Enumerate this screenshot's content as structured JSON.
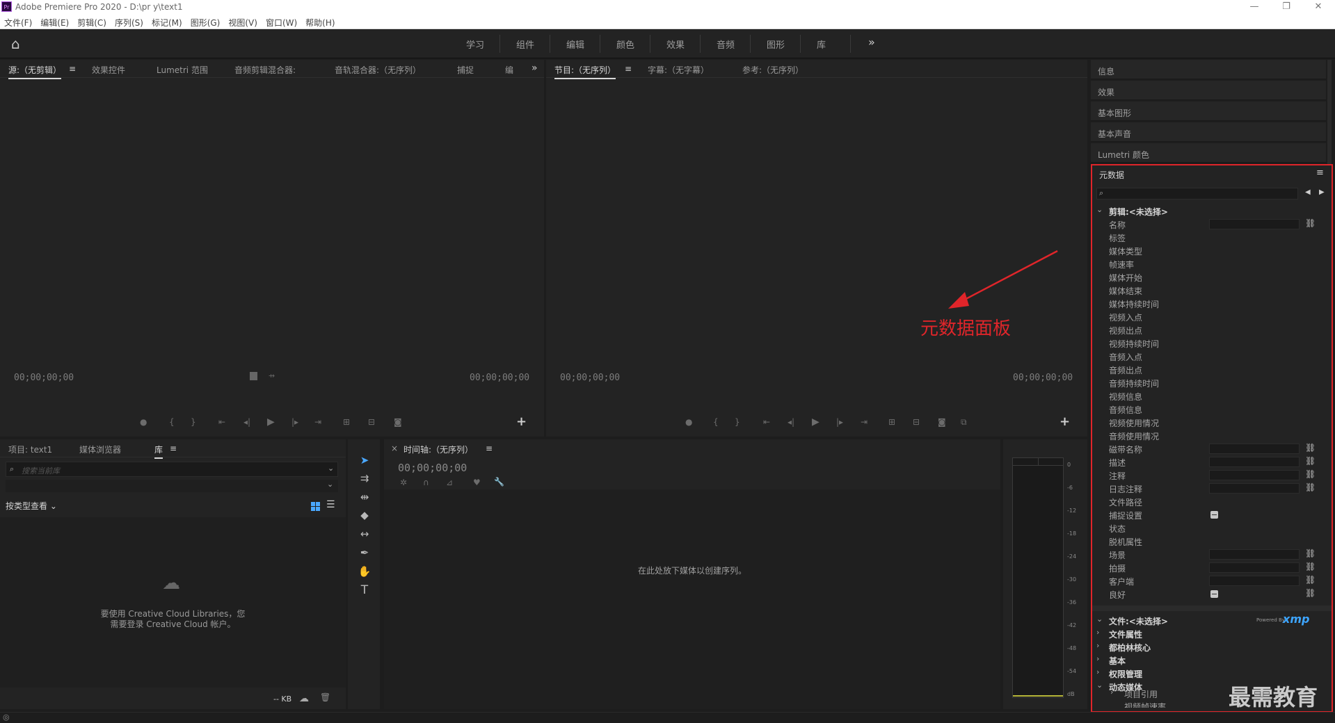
{
  "window": {
    "title": "Adobe Premiere Pro 2020 - D:\\pr y\\text1",
    "app_icon": "Pr",
    "minimize": "—",
    "restore": "❐",
    "close": "✕"
  },
  "menu": [
    "文件(F)",
    "编辑(E)",
    "剪辑(C)",
    "序列(S)",
    "标记(M)",
    "图形(G)",
    "视图(V)",
    "窗口(W)",
    "帮助(H)"
  ],
  "workspaces": [
    "学习",
    "组件",
    "编辑",
    "颜色",
    "效果",
    "音频",
    "图形",
    "库"
  ],
  "workspace_more": "»",
  "source_panel": {
    "tabs": [
      "源:（无剪辑）",
      "效果控件",
      "Lumetri 范围",
      "音频剪辑混合器:",
      "音轨混合器:（无序列）",
      "捕捉",
      "编"
    ],
    "more": "»",
    "timecode_left": "00;00;00;00",
    "timecode_right": "00;00;00;00"
  },
  "program_panel": {
    "tabs": [
      "节目:（无序列）",
      "字幕:（无字幕）",
      "参考:（无序列）"
    ],
    "timecode_left": "00;00;00;00",
    "timecode_right": "00;00;00;00"
  },
  "annotation": {
    "text": "元数据面板",
    "color": "#e0252a"
  },
  "project_panel": {
    "tabs": [
      "项目: text1",
      "媒体浏览器",
      "库"
    ],
    "search_placeholder": "搜索当前库",
    "view_by": "按类型查看",
    "cc_message_line1": "要使用 Creative Cloud Libraries，您",
    "cc_message_line2": "需要登录 Creative Cloud 帐户。",
    "size": "-- KB"
  },
  "timeline_panel": {
    "close": "×",
    "tab": "时间轴:（无序列）",
    "timecode": "00;00;00;00",
    "drop_message": "在此处放下媒体以创建序列。"
  },
  "audio_meter": {
    "labels": [
      "0",
      "-6",
      "-12",
      "-18",
      "-24",
      "-30",
      "-36",
      "-42",
      "-48",
      "-54",
      "dB"
    ]
  },
  "right_tabs": [
    "信息",
    "效果",
    "基本图形",
    "基本声音",
    "Lumetri 颜色"
  ],
  "metadata": {
    "title": "元数据",
    "clip_section": "剪辑:<未选择>",
    "clip_fields": [
      {
        "label": "名称",
        "field": true,
        "link": true
      },
      {
        "label": "标签"
      },
      {
        "label": "媒体类型"
      },
      {
        "label": "帧速率"
      },
      {
        "label": "媒体开始"
      },
      {
        "label": "媒体结束"
      },
      {
        "label": "媒体持续时间"
      },
      {
        "label": "视频入点"
      },
      {
        "label": "视频出点"
      },
      {
        "label": "视频持续时间"
      },
      {
        "label": "音频入点"
      },
      {
        "label": "音频出点"
      },
      {
        "label": "音频持续时间"
      },
      {
        "label": "视频信息"
      },
      {
        "label": "音频信息"
      },
      {
        "label": "视频使用情况"
      },
      {
        "label": "音频使用情况"
      },
      {
        "label": "磁带名称",
        "field": true,
        "link": true
      },
      {
        "label": "描述",
        "field": true,
        "link": true
      },
      {
        "label": "注释",
        "field": true,
        "link": true
      },
      {
        "label": "日志注释",
        "field": true,
        "link": true
      },
      {
        "label": "文件路径"
      },
      {
        "label": "捕捉设置",
        "check": true
      },
      {
        "label": "状态"
      },
      {
        "label": "脱机属性"
      },
      {
        "label": "场景",
        "field": true,
        "link": true
      },
      {
        "label": "拍摄",
        "field": true,
        "link": true
      },
      {
        "label": "客户端",
        "field": true,
        "link": true
      },
      {
        "label": "良好",
        "check": true,
        "link": true
      }
    ],
    "file_section": "文件:<未选择>",
    "powered_by": "Powered By",
    "xmp": "xmp",
    "file_groups": [
      "文件属性",
      "都柏林核心",
      "基本",
      "权限管理",
      "动态媒体"
    ],
    "sub_item": "项目引用",
    "sub_item_cut": "视频帧速率"
  },
  "watermark": "最需教育"
}
